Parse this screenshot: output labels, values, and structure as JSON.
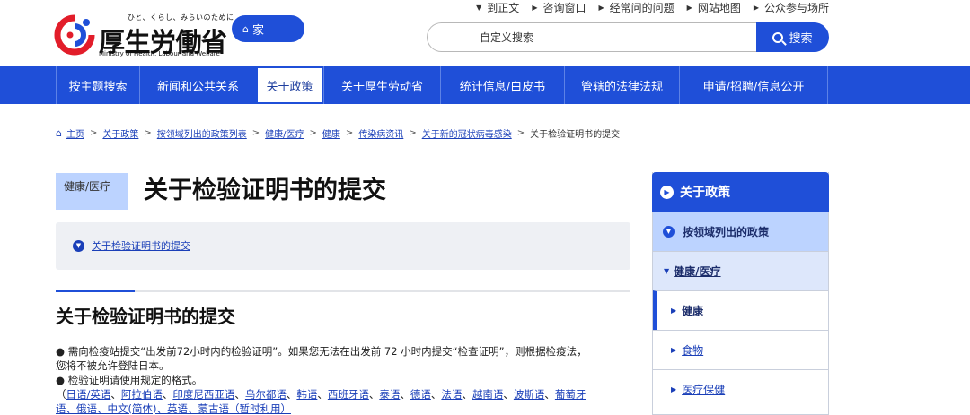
{
  "header": {
    "logo": {
      "tagline": "ひと、くらし、みらいのために",
      "title": "厚生労働省",
      "english": "Ministry of Health, Labour and Welfare"
    },
    "home_label": "家",
    "utility_links": [
      "到正文",
      "咨询窗口",
      "经常问的问题",
      "网站地图",
      "公众参与场所"
    ],
    "search": {
      "placeholder": "自定义搜索",
      "button_label": "搜索"
    }
  },
  "global_nav": {
    "items": [
      "按主题搜索",
      "新闻和公共关系",
      "关于政策",
      "关于厚生劳动省",
      "统计信息/白皮书",
      "管辖的法律法规",
      "申请/招聘/信息公开"
    ],
    "active_index": 2
  },
  "breadcrumb": {
    "items": [
      "主页",
      "关于政策",
      "按领域列出的政策列表",
      "健康/医疗",
      "健康",
      "传染病资讯",
      "关于新的冠状病毒感染"
    ],
    "current": "关于检验证明书的提交"
  },
  "main": {
    "category": "健康/医疗",
    "title": "关于检验证明书的提交",
    "toc": [
      "关于检验证明书的提交"
    ],
    "section_heading": "关于检验证明书的提交",
    "paragraph1_line1": "●  需向检疫站提交“出发前72小时内的检验证明”。如果您无法在出发前 72 小时内提交“检查证明”，则根据检疫法，",
    "paragraph1_line2": "您将不被允许登陆日本。",
    "paragraph2": "●  检验证明请使用规定的格式。",
    "languages_open": "（",
    "languages": [
      "日语/英语",
      "阿拉伯语",
      "印度尼西亚语",
      "乌尔都语",
      "韩语",
      "西班牙语",
      "泰语",
      "德语",
      "法语",
      "越南语",
      "波斯语",
      "葡萄牙"
    ],
    "languages_line2": "语、俄语、中文(简体)、英语、蒙古语（暂时利用）"
  },
  "side_nav": {
    "title": "关于政策",
    "level1": "按领域列出的政策",
    "level2": "健康/医疗",
    "items": [
      "健康",
      "食物",
      "医疗保健"
    ]
  }
}
